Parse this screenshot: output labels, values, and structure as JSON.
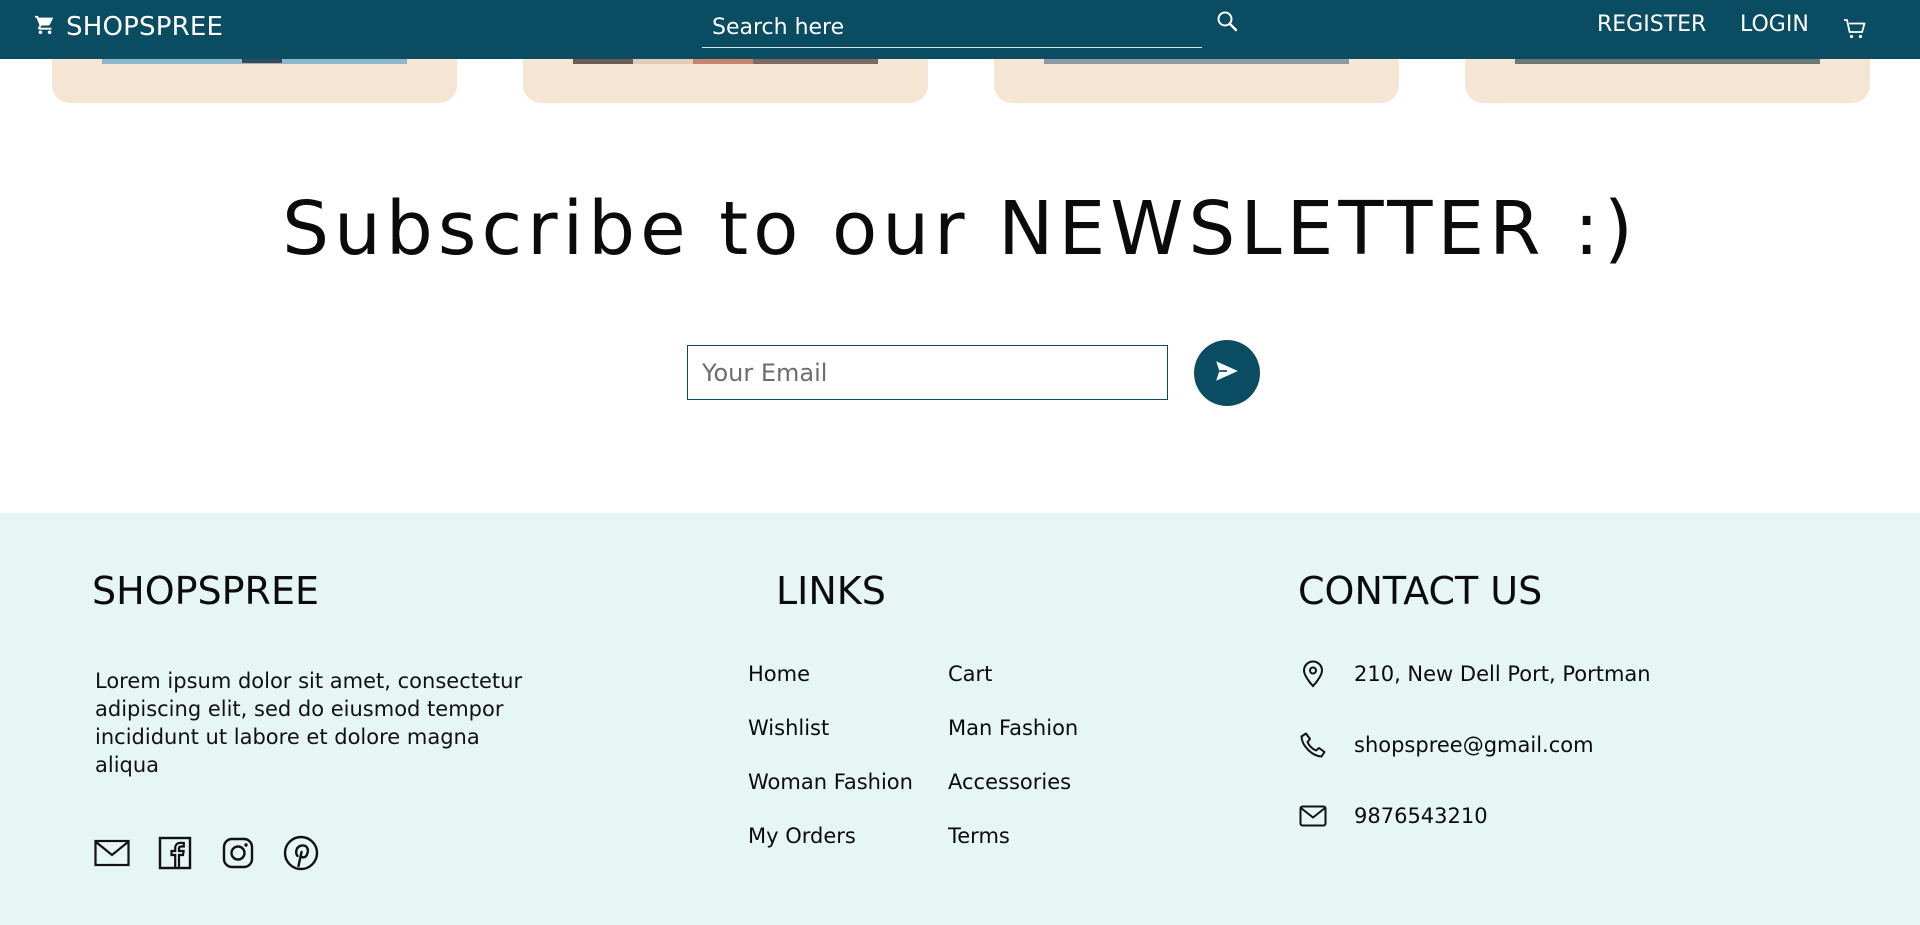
{
  "navbar": {
    "brand": "SHOPSPREE",
    "search_placeholder": "Search here",
    "register": "REGISTER",
    "login": "LOGIN"
  },
  "newsletter": {
    "title": "Subscribe to our NEWSLETTER :)",
    "email_placeholder": "Your Email"
  },
  "footer": {
    "brand_heading": "SHOPSPREE",
    "description": "Lorem ipsum dolor sit amet, consectetur adipiscing elit, sed do eiusmod tempor incididunt ut labore et dolore magna aliqua",
    "links_heading": "LINKS",
    "links": [
      "Home",
      "Cart",
      "Wishlist",
      "Man Fashion",
      "Woman Fashion",
      "Accessories",
      "My Orders",
      "Terms"
    ],
    "contact_heading": "CONTACT US",
    "contact": {
      "address": "210, New Dell Port, Portman",
      "email": "shopspree@gmail.com",
      "phone": "9876543210"
    }
  },
  "colors": {
    "primary": "#0a4d62",
    "card_bg": "#f4e6d2",
    "footer_bg": "#e6f6f3"
  }
}
